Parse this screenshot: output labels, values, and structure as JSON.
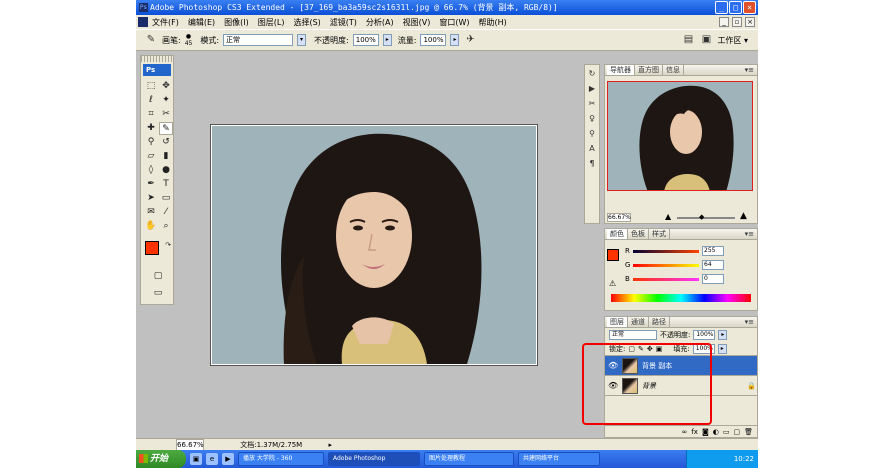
{
  "window": {
    "title": "Adobe Photoshop CS3 Extended - [37_169_ba3a59sc2s1631l.jpg @ 66.7% (背景 副本, RGB/8)]",
    "app_icon": "Ps",
    "buttons": [
      "_",
      "□",
      "×"
    ]
  },
  "menu": {
    "items": [
      "文件(F)",
      "编辑(E)",
      "图像(I)",
      "图层(L)",
      "选择(S)",
      "滤镜(T)",
      "分析(A)",
      "视图(V)",
      "窗口(W)",
      "帮助(H)"
    ]
  },
  "options": {
    "size_label": "画笔:",
    "size_value": "45",
    "mode_label": "模式:",
    "mode_value": "正常",
    "opacity_label": "不透明度:",
    "opacity_value": "100%",
    "flow_label": "流量:",
    "flow_value": "100%",
    "workspace_label": "工作区 ▾"
  },
  "toolbox": {
    "logo": "Ps",
    "fg_color": "#ff3300",
    "bg_color": "#ffffff"
  },
  "status": {
    "zoom": "66.67%",
    "doc": "文档:1.37M/2.75M"
  },
  "navigator": {
    "tabs": [
      "导航器",
      "直方图",
      "信息"
    ],
    "zoom": "66.67%"
  },
  "color": {
    "tabs": [
      "颜色",
      "色板",
      "样式"
    ],
    "channels": [
      {
        "label": "R",
        "value": "255"
      },
      {
        "label": "G",
        "value": "64"
      },
      {
        "label": "B",
        "value": "0"
      }
    ]
  },
  "layers": {
    "tabs": [
      "图层",
      "通道",
      "路径"
    ],
    "blend_mode": "正常",
    "opacity_label": "不透明度:",
    "opacity_value": "100%",
    "lock_label": "锁定:",
    "fill_label": "填充:",
    "fill_value": "100%",
    "items": [
      {
        "name": "背景 副本",
        "selected": true
      },
      {
        "name": "背景",
        "selected": false
      }
    ]
  },
  "taskbar": {
    "start": "开始",
    "tasks": [
      "播放 大学院 - 360",
      "Adobe Photoshop",
      "图片处理教程",
      "共建网络平台"
    ],
    "time": "10:22"
  },
  "annotation": {
    "color": "#f20000"
  }
}
